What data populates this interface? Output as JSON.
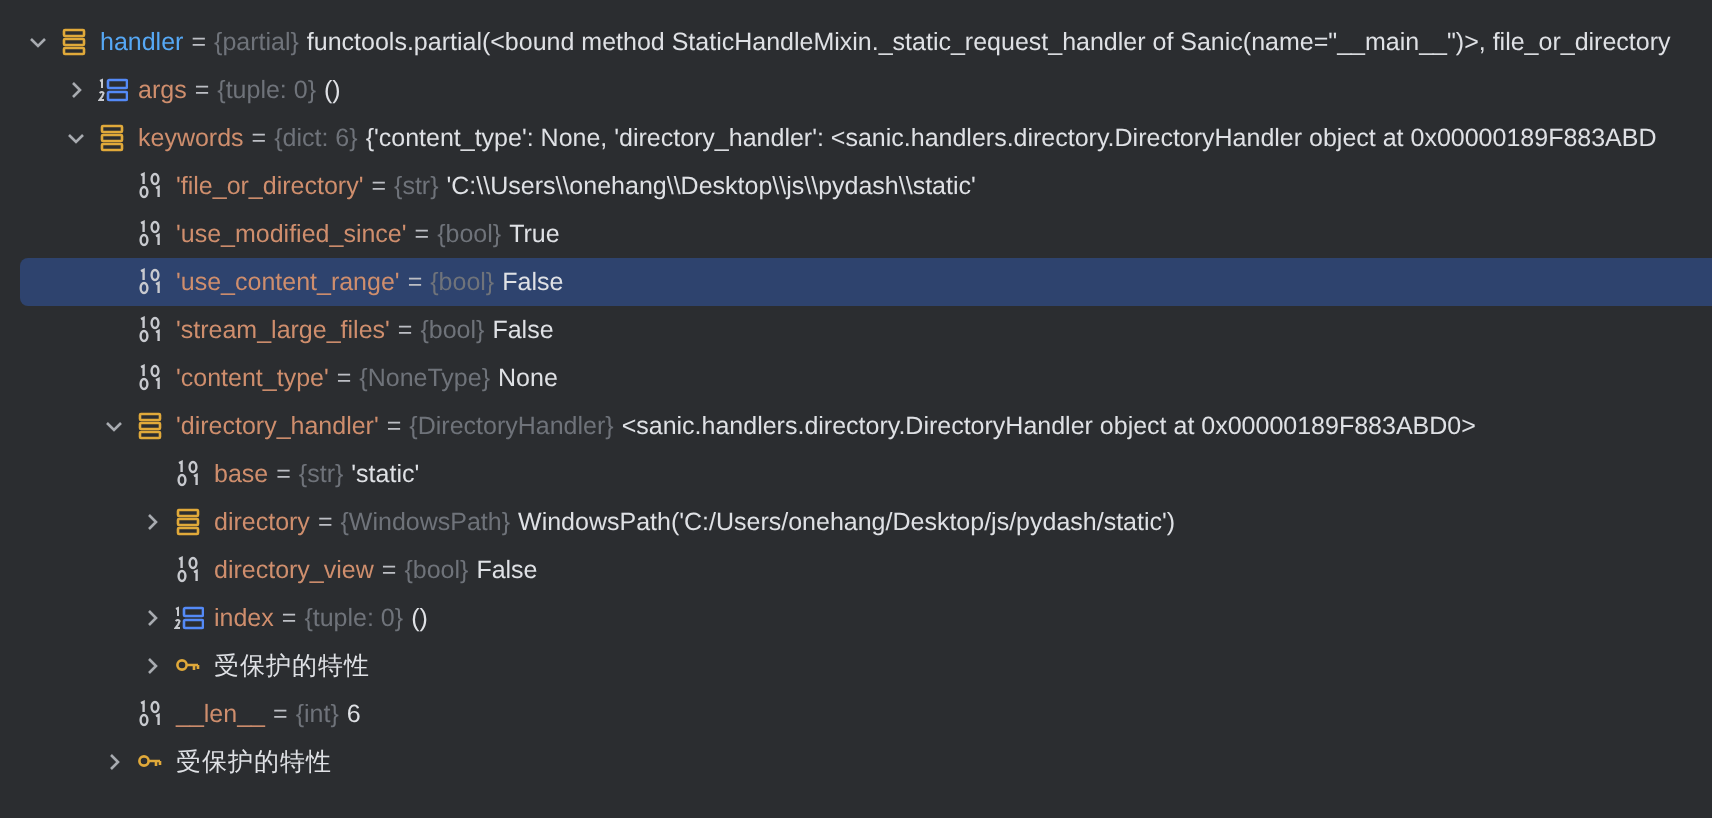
{
  "tree": [
    {
      "kind": "object",
      "name": "handler",
      "separator": "=",
      "type": "{partial}",
      "value": "functools.partial(<bound method StaticHandleMixin._static_request_handler of Sanic(name=\"__main__\")>, file_or_directory",
      "expanded": true,
      "selected": false,
      "highlighted": true,
      "children": [
        {
          "kind": "list",
          "name": "args",
          "separator": "=",
          "type": "{tuple: 0}",
          "value": "()",
          "expanded": false,
          "selected": false,
          "highlighted": false
        },
        {
          "kind": "object",
          "name": "keywords",
          "separator": "=",
          "type": "{dict: 6}",
          "value": "{'content_type': None, 'directory_handler': <sanic.handlers.directory.DirectoryHandler object at 0x00000189F883ABD",
          "expanded": true,
          "selected": false,
          "highlighted": false,
          "children": [
            {
              "kind": "scalar",
              "name": "'file_or_directory'",
              "separator": "=",
              "type": "{str}",
              "value": "'C:\\\\Users\\\\onehang\\\\Desktop\\\\js\\\\pydash\\\\static'",
              "selected": false,
              "highlighted": false
            },
            {
              "kind": "scalar",
              "name": "'use_modified_since'",
              "separator": "=",
              "type": "{bool}",
              "value": "True",
              "selected": false,
              "highlighted": false
            },
            {
              "kind": "scalar",
              "name": "'use_content_range'",
              "separator": "=",
              "type": "{bool}",
              "value": "False",
              "selected": true,
              "highlighted": false
            },
            {
              "kind": "scalar",
              "name": "'stream_large_files'",
              "separator": "=",
              "type": "{bool}",
              "value": "False",
              "selected": false,
              "highlighted": false
            },
            {
              "kind": "scalar",
              "name": "'content_type'",
              "separator": "=",
              "type": "{NoneType}",
              "value": "None",
              "selected": false,
              "highlighted": false
            },
            {
              "kind": "object",
              "name": "'directory_handler'",
              "separator": "=",
              "type": "{DirectoryHandler}",
              "value": "<sanic.handlers.directory.DirectoryHandler object at 0x00000189F883ABD0>",
              "expanded": true,
              "selected": false,
              "highlighted": false,
              "children": [
                {
                  "kind": "scalar",
                  "name": "base",
                  "separator": "=",
                  "type": "{str}",
                  "value": "'static'",
                  "selected": false,
                  "highlighted": false
                },
                {
                  "kind": "object",
                  "name": "directory",
                  "separator": "=",
                  "type": "{WindowsPath}",
                  "value": "WindowsPath('C:/Users/onehang/Desktop/js/pydash/static')",
                  "expanded": false,
                  "selected": false,
                  "highlighted": false
                },
                {
                  "kind": "scalar",
                  "name": "directory_view",
                  "separator": "=",
                  "type": "{bool}",
                  "value": "False",
                  "selected": false,
                  "highlighted": false
                },
                {
                  "kind": "list",
                  "name": "index",
                  "separator": "=",
                  "type": "{tuple: 0}",
                  "value": "()",
                  "expanded": false,
                  "selected": false,
                  "highlighted": false
                },
                {
                  "kind": "protected",
                  "label": "受保护的特性",
                  "expanded": false,
                  "selected": false
                }
              ]
            },
            {
              "kind": "scalar",
              "name": "__len__",
              "separator": "=",
              "type": "{int}",
              "value": "6",
              "selected": false,
              "highlighted": false
            },
            {
              "kind": "protected",
              "label": "受保护的特性",
              "expanded": false,
              "selected": false
            }
          ]
        }
      ]
    }
  ]
}
